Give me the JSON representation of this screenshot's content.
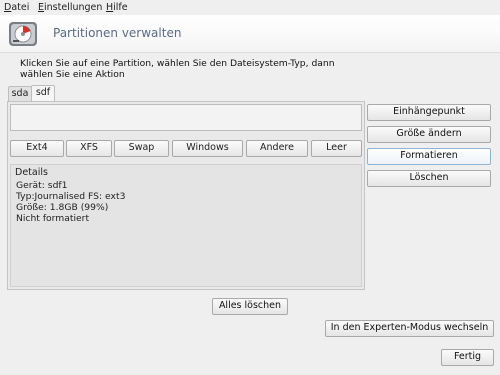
{
  "menu": {
    "items": [
      {
        "underline": "D",
        "rest": "atei"
      },
      {
        "underline": "E",
        "rest": "instellungen"
      },
      {
        "underline": "H",
        "rest": "ilfe"
      }
    ]
  },
  "header": {
    "title": "Partitionen verwalten",
    "icon": "disk-partition-icon"
  },
  "instruction": {
    "line1": "Klicken Sie auf eine Partition, wählen Sie den Dateisystem-Typ, dann",
    "line2": "wählen Sie eine Aktion"
  },
  "tabs": [
    {
      "label": "sda",
      "active": false
    },
    {
      "label": "sdf",
      "active": true
    }
  ],
  "filesystem_buttons": [
    "Ext4",
    "XFS",
    "Swap",
    "Windows",
    "Andere",
    "Leer"
  ],
  "details": {
    "title": "Details",
    "lines": [
      "Gerät: sdf1",
      "Typ:Journalised FS: ext3",
      "Größe: 1.8GB (99%)",
      "Nicht formatiert"
    ]
  },
  "actions": [
    "Einhängepunkt",
    "Größe ändern",
    "Formatieren",
    "Löschen"
  ],
  "buttons": {
    "clear_all": "Alles löschen",
    "expert_mode": "In den Experten-Modus wechseln",
    "done": "Fertig"
  },
  "colors": {
    "title_text": "#5a6c85",
    "focus_border": "#8fb3d6",
    "icon_red": "#d2322d"
  }
}
